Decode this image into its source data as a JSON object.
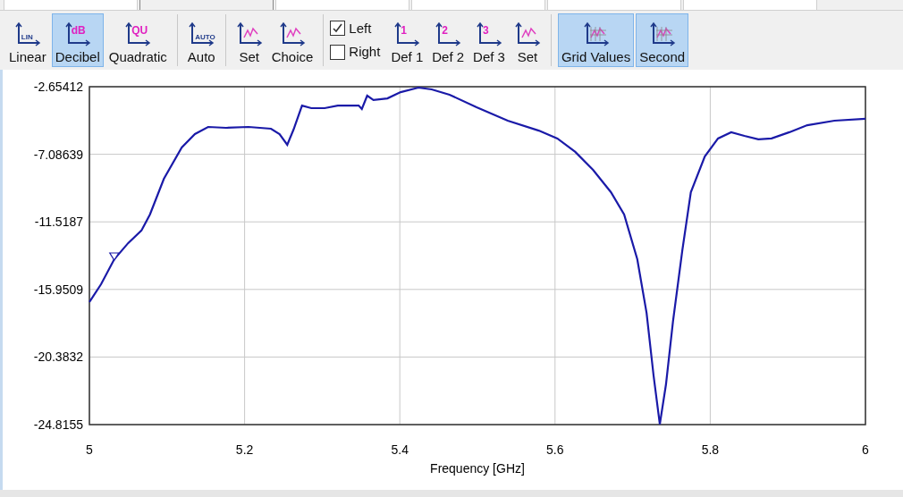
{
  "tabs": [
    {
      "selected": false
    },
    {
      "selected": true
    },
    {
      "selected": false
    },
    {
      "selected": false
    },
    {
      "selected": false
    },
    {
      "selected": false
    }
  ],
  "toolbar": [
    {
      "kind": "button",
      "label": "Linear",
      "icon_text": "LIN",
      "selected": false
    },
    {
      "kind": "button",
      "label": "Decibel",
      "icon_text": "dB",
      "selected": true
    },
    {
      "kind": "button",
      "label": "Quadratic",
      "icon_text": "QU",
      "selected": false
    },
    {
      "kind": "separator"
    },
    {
      "kind": "button",
      "label": "Auto",
      "icon_text": "AUTO",
      "selected": false
    },
    {
      "kind": "separator"
    },
    {
      "kind": "button",
      "label": "Set",
      "selected": false
    },
    {
      "kind": "button",
      "label": "Choice",
      "selected": false
    },
    {
      "kind": "separator"
    },
    {
      "kind": "checks",
      "items": [
        {
          "label": "Left",
          "checked": true
        },
        {
          "label": "Right",
          "checked": false
        }
      ]
    },
    {
      "kind": "button",
      "label": "Def 1",
      "icon_text": "1",
      "selected": false
    },
    {
      "kind": "button",
      "label": "Def 2",
      "icon_text": "2",
      "selected": false
    },
    {
      "kind": "button",
      "label": "Def 3",
      "icon_text": "3",
      "selected": false
    },
    {
      "kind": "button",
      "label": "Set",
      "selected": false
    },
    {
      "kind": "separator"
    },
    {
      "kind": "button",
      "label": "Grid Values",
      "selected": true
    },
    {
      "kind": "button",
      "label": "Second",
      "selected": true
    }
  ],
  "chart": {
    "chart_data": {
      "type": "line",
      "xlabel": "Frequency [GHz]",
      "xlim": [
        5,
        6
      ],
      "ylim": [
        -24.8155,
        -2.65412
      ],
      "xticks": [
        5,
        {
          "value": 5.2,
          "label": "5.2"
        },
        {
          "value": 5.4,
          "label": "5.4"
        },
        {
          "value": 5.6,
          "label": "5.6"
        },
        {
          "value": 5.8,
          "label": "5.8"
        },
        6
      ],
      "yticks": [
        {
          "value": -2.65412,
          "label": "-2.65412"
        },
        {
          "value": -7.08639,
          "label": "-7.08639"
        },
        {
          "value": -11.5187,
          "label": "-11.5187"
        },
        {
          "value": -15.9509,
          "label": "-15.9509"
        },
        {
          "value": -20.3832,
          "label": "-20.3832"
        },
        {
          "value": -24.8155,
          "label": "-24.8155"
        }
      ],
      "x": [
        5.0,
        5.015,
        5.032,
        5.05,
        5.067,
        5.078,
        5.096,
        5.119,
        5.136,
        5.153,
        5.176,
        5.205,
        5.234,
        5.245,
        5.255,
        5.263,
        5.274,
        5.286,
        5.303,
        5.32,
        5.347,
        5.351,
        5.358,
        5.366,
        5.384,
        5.401,
        5.424,
        5.441,
        5.464,
        5.499,
        5.539,
        5.579,
        5.603,
        5.626,
        5.649,
        5.672,
        5.689,
        5.706,
        5.718,
        5.727,
        5.735,
        5.743,
        5.752,
        5.764,
        5.775,
        5.793,
        5.81,
        5.827,
        5.844,
        5.862,
        5.879,
        5.902,
        5.925,
        5.96,
        6.0
      ],
      "series": [
        {
          "color": "#1a1aa8",
          "values": [
            -16.78,
            -15.61,
            -13.97,
            -12.91,
            -12.09,
            -11.04,
            -8.69,
            -6.64,
            -5.76,
            -5.29,
            -5.35,
            -5.29,
            -5.41,
            -5.76,
            -6.46,
            -5.47,
            -3.89,
            -4.06,
            -4.06,
            -3.89,
            -3.89,
            -4.12,
            -3.24,
            -3.53,
            -3.42,
            -3.01,
            -2.71,
            -2.83,
            -3.18,
            -4.0,
            -4.88,
            -5.53,
            -6.05,
            -6.93,
            -8.11,
            -9.57,
            -11.04,
            -13.97,
            -17.49,
            -21.59,
            -24.8,
            -22.18,
            -18.07,
            -13.38,
            -9.57,
            -7.23,
            -6.05,
            -5.64,
            -5.88,
            -6.11,
            -6.05,
            -5.64,
            -5.18,
            -4.88,
            -4.76
          ]
        }
      ],
      "grid": true
    }
  }
}
